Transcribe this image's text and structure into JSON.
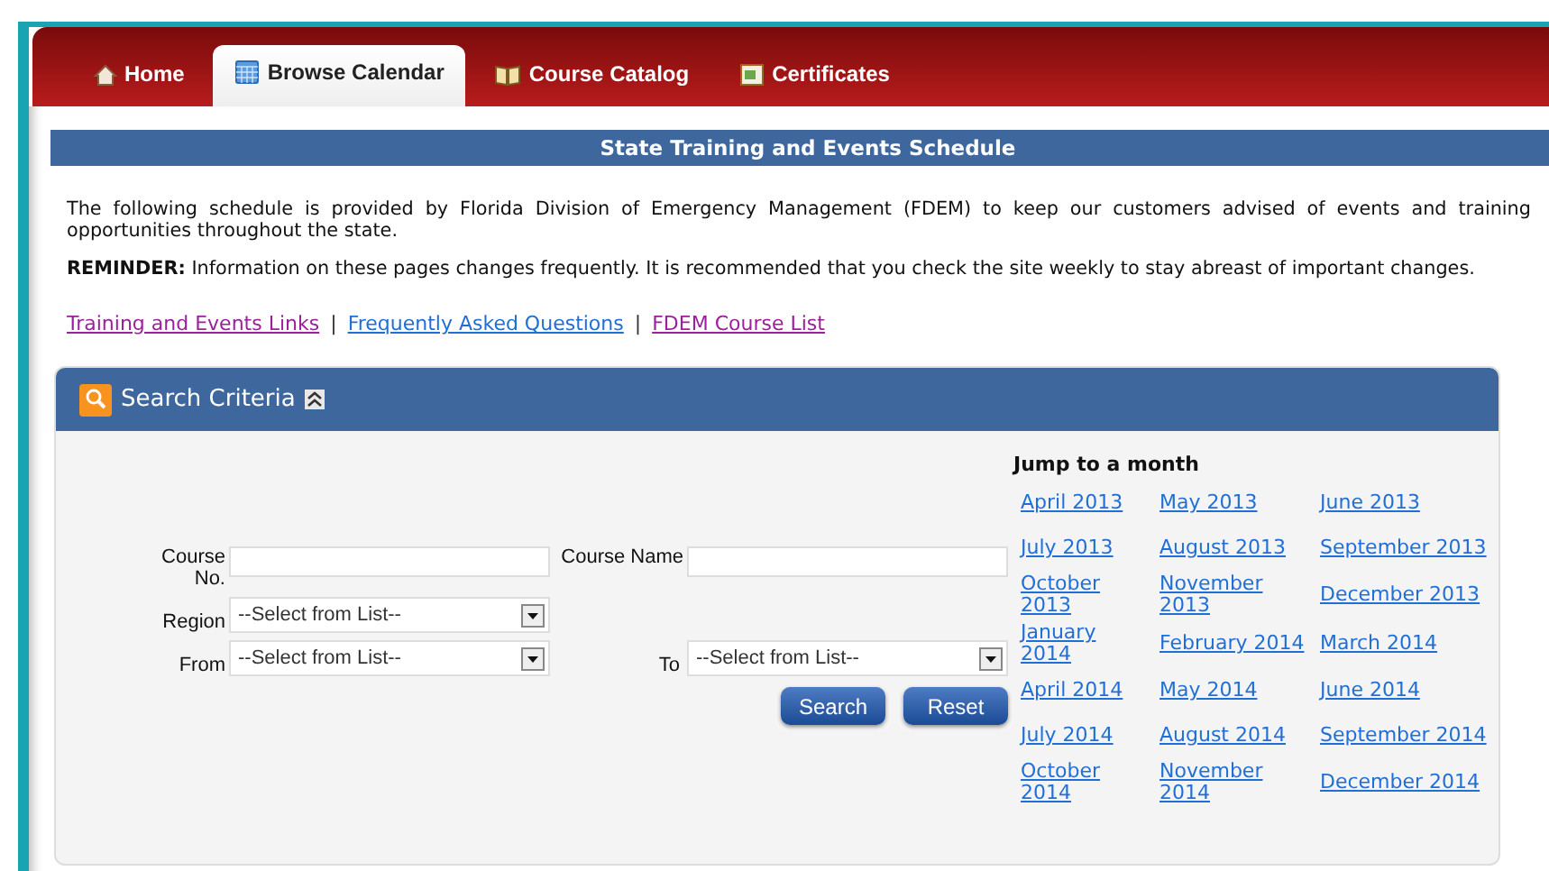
{
  "tabs": [
    {
      "label": "Home",
      "kind": "home",
      "selected": false
    },
    {
      "label": "Browse Calendar",
      "kind": "calendar",
      "selected": true
    },
    {
      "label": "Course Catalog",
      "kind": "book",
      "selected": false
    },
    {
      "label": "Certificates",
      "kind": "certificate",
      "selected": false
    }
  ],
  "title_bar": "State Training and Events Schedule",
  "intro": "The following schedule is provided by Florida Division of Emergency Management (FDEM) to keep our customers advised of events and training opportunities throughout the state.",
  "reminder": "**REMINDER:** Information on these pages changes frequently. It is recommended that you check the site weekly to stay abreast of important changes.",
  "links": [
    {
      "label": "Training and Events Links",
      "visited": true
    },
    {
      "label": "Frequently Asked Questions",
      "visited": false
    },
    {
      "label": "FDEM Course List",
      "visited": true
    }
  ],
  "link_separator": "|",
  "search_panel": {
    "title": "Search Criteria",
    "expanded": true,
    "fields": {
      "course_no": {
        "label": "Course No."
      },
      "course_name": {
        "label": "Course Name"
      },
      "region": {
        "label": "Region",
        "value": "--Select from List--"
      },
      "from": {
        "label": "From",
        "value": "--Select from List--"
      },
      "to": {
        "label": "To",
        "value": "--Select from List--"
      }
    },
    "buttons": [
      "Search",
      "Reset"
    ],
    "jump_heading": "Jump to a month",
    "months": [
      "April 2013",
      "May 2013",
      "June 2013",
      "July 2013",
      "August 2013",
      "September 2013",
      "October 2013",
      "November 2013",
      "December 2013",
      "January 2014",
      "February 2014",
      "March 2014",
      "April 2014",
      "May 2014",
      "June 2014",
      "July 2014",
      "August 2014",
      "September 2014",
      "October 2014",
      "November 2014",
      "December 2014"
    ]
  }
}
